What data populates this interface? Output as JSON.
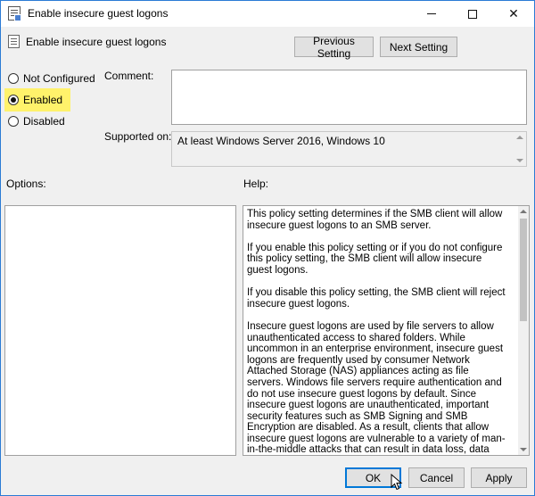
{
  "window": {
    "title": "Enable insecure guest logons",
    "colors": {
      "accent": "#0078d7",
      "highlight": "#fff26b",
      "face": "#f0f0f0"
    }
  },
  "header": {
    "title": "Enable insecure guest logons",
    "prev_label": "Previous Setting",
    "next_label": "Next Setting"
  },
  "state": {
    "options": [
      {
        "label": "Not Configured",
        "checked": false
      },
      {
        "label": "Enabled",
        "checked": true
      },
      {
        "label": "Disabled",
        "checked": false
      }
    ]
  },
  "comment": {
    "label": "Comment:",
    "value": ""
  },
  "supported": {
    "label": "Supported on:",
    "value": "At least Windows Server 2016, Windows 10"
  },
  "options_panel": {
    "label": "Options:"
  },
  "help_panel": {
    "label": "Help:",
    "paragraphs": [
      "This policy setting determines if the SMB client will allow insecure guest logons to an SMB server.",
      "If you enable this policy setting or if you do not configure this policy setting, the SMB client will allow insecure guest logons.",
      "If you disable this policy setting, the SMB client will reject insecure guest logons.",
      "Insecure guest logons are used by file servers to allow unauthenticated access to shared folders. While uncommon in an enterprise environment, insecure guest logons are frequently used by consumer Network Attached Storage (NAS) appliances acting as file servers. Windows file servers require authentication and do not use insecure guest logons by default. Since insecure guest logons are unauthenticated, important security features such as SMB Signing and SMB Encryption are disabled. As a result, clients that allow insecure guest logons are vulnerable to a variety of man-in-the-middle attacks that can result in data loss, data corruption, and exposure to malware. Additionally, any data written to a file server using an insecure guest logon is"
    ]
  },
  "footer": {
    "ok_label": "OK",
    "cancel_label": "Cancel",
    "apply_label": "Apply"
  },
  "icons": {
    "title": "policy-document-icon",
    "header": "policy-document-icon",
    "minimize": "minimize-icon",
    "maximize": "maximize-icon",
    "close": "close-icon",
    "cursor": "mouse-pointer-icon"
  }
}
